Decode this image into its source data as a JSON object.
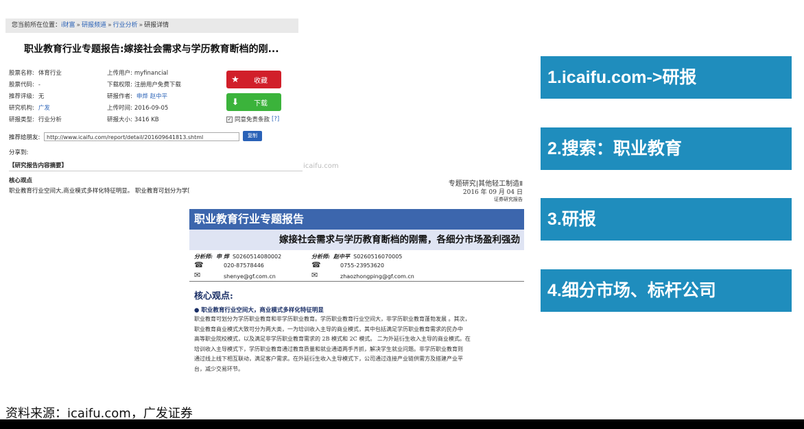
{
  "breadcrumb": {
    "prefix": "您当前所在位置：",
    "items": [
      "i财富",
      "研报频道",
      "行业分析",
      "研报详情"
    ],
    "separator": "»"
  },
  "report_title": "职业教育行业专题报告:嫁接社会需求与学历教育断档的刚...",
  "meta_left": [
    {
      "label": "股票名称:",
      "value": "体育行业"
    },
    {
      "label": "股票代码:",
      "value": "-"
    },
    {
      "label": "推荐评级:",
      "value": "无"
    },
    {
      "label": "研究机构:",
      "value": "广发"
    },
    {
      "label": "研报类型:",
      "value": "行业分析"
    }
  ],
  "meta_right": [
    {
      "label": "上传用户:",
      "value": "myfinancial"
    },
    {
      "label": "下载权限:",
      "value": "注册用户免费下载"
    },
    {
      "label": "研报作者:",
      "value": "申烨  赵中平"
    },
    {
      "label": "上传时间:",
      "value": "2016-09-05"
    },
    {
      "label": "研报大小:",
      "value": "3416 KB"
    }
  ],
  "buttons": {
    "collect": {
      "label": "收藏",
      "icon": "star-icon"
    },
    "download": {
      "label": "下载",
      "icon": "download-icon"
    }
  },
  "agree": {
    "text": "同意免责条款",
    "link": "[?]"
  },
  "share": {
    "label": "推荐给朋友:",
    "url": "http://www.icaifu.com/report/detail/201609641813.shtml",
    "copy_label": "复制",
    "share_to": "分享到:"
  },
  "summary_heading": "【研究报告内容摘要】",
  "core_heading": "核心观点",
  "core_text": "职业教育行业空间大,商业模式多样化特征明显。 职业教育可划分为学历职业教育和非学历职业教育。学历职业",
  "watermark": "icaifu.com",
  "report_page": {
    "topline": "专题研究|其他轻工制造Ⅱ",
    "date": "2016 年 09 月 04 日",
    "subline": "证券研究报告",
    "band_title": "职业教育行业专题报告",
    "band_subtitle": "嫁接社会需求与学历教育断档的刚需，各细分市场盈利强劲",
    "analysts": [
      {
        "role": "分析师:",
        "name": "申  烨",
        "id": "S0260514080002",
        "phone": "020-87578446",
        "email": "shenye@gf.com.cn"
      },
      {
        "role": "分析师:",
        "name": "赵中平",
        "id": "S0260516070005",
        "phone": "0755-23953620",
        "email": "zhaozhongping@gf.com.cn"
      }
    ],
    "core_title": "核心观点:",
    "bullet": "●  职业教育行业空间大，商业模式多样化特征明显",
    "paragraph_lines": [
      "职业教育可划分为学历职业教育和非学历职业教育。学历职业教育行业空间大，非学历职业教育蓬勃发展 。其次，",
      "职业教育商业模式大致可分为两大类，一为培训收入主导的商业模式，其中包括满足学历职业教育需求的民办中",
      "高等职业院校模式，以及满足非学历职业教育需求的 2B 模式和 2C 模式。 二为外延衍生收入主导的商业模式。在",
      "培训收入主导模式下，学历职业教育通过教育质量和就业通道两手齐抓，解决学生就业问题。非学历职业教育则",
      "通过线上线下相互联动，满足客户需求。在外延衍生收入主导模式下，公司通过连接产业链供需方及搭建产业平",
      "台，减少交易环节。"
    ]
  },
  "steps": [
    "1.icaifu.com->研报",
    "2.搜索：职业教育",
    "3.研报",
    "4.细分市场、标杆公司"
  ],
  "source_note": "资料来源：icaifu.com，广发证券",
  "colors": {
    "step_bg": "#1f8dbd",
    "collect_bg": "#d11f2a",
    "download_bg": "#3bb33b",
    "report_band": "#3c66ad"
  }
}
